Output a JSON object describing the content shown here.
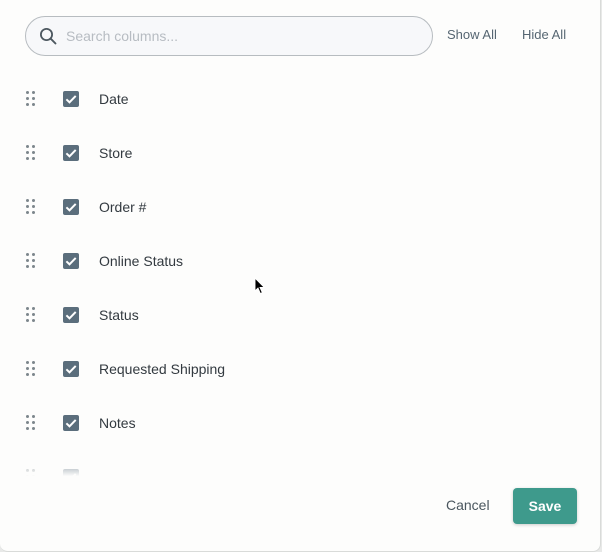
{
  "search": {
    "placeholder": "Search columns..."
  },
  "actions": {
    "show_all": "Show All",
    "hide_all": "Hide All"
  },
  "columns": [
    {
      "label": "Date",
      "checked": true
    },
    {
      "label": "Store",
      "checked": true
    },
    {
      "label": "Order #",
      "checked": true
    },
    {
      "label": "Online Status",
      "checked": true
    },
    {
      "label": "Status",
      "checked": true
    },
    {
      "label": "Requested Shipping",
      "checked": true
    },
    {
      "label": "Notes",
      "checked": true
    },
    {
      "label": "",
      "checked": true
    }
  ],
  "footer": {
    "cancel": "Cancel",
    "save": "Save"
  },
  "colors": {
    "accent": "#3e9a8c",
    "checkbox": "#5b6e7c",
    "link": "#566672"
  },
  "icons": {
    "search": "search-icon",
    "drag": "drag-handle-icon",
    "check": "check-icon",
    "cursor": "mouse-pointer-icon"
  }
}
